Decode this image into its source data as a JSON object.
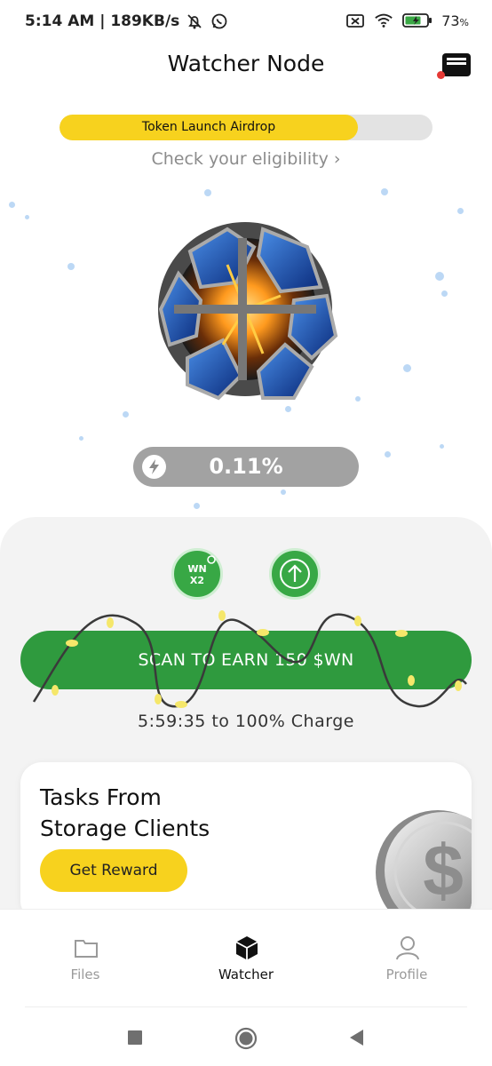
{
  "status_bar": {
    "time_network": "5:14 AM | 189KB/s",
    "battery": "73",
    "battery_unit": "%",
    "icons": [
      "mute-bell-icon",
      "whatsapp-icon",
      "sim-off-icon",
      "wifi-icon",
      "battery-charging-icon"
    ]
  },
  "header": {
    "title": "Watcher Node",
    "wallet_icon": "wallet-icon"
  },
  "airdrop": {
    "label": "Token Launch Airdrop",
    "progress": 0.8,
    "eligibility_text": "Check your eligibility ›"
  },
  "charge": {
    "value": "0.11%",
    "icon": "lightning-icon"
  },
  "boosts": {
    "multiplier_line1": "WN",
    "multiplier_line2": "X2",
    "upgrade_icon": "arrow-up-icon"
  },
  "scan": {
    "label": "SCAN TO EARN 150 $WN",
    "timer": "5:59:35 to 100% Charge"
  },
  "task_card": {
    "title_line1": "Tasks From",
    "title_line2": "Storage Clients",
    "button_label": "Get Reward",
    "image_icon": "dollar-coin-icon"
  },
  "nav": {
    "items": [
      {
        "label": "Files",
        "icon": "folder-icon",
        "active": false
      },
      {
        "label": "Watcher",
        "icon": "cube-icon",
        "active": true
      },
      {
        "label": "Profile",
        "icon": "person-icon",
        "active": false
      }
    ]
  },
  "colors": {
    "accent_green": "#2f9a3e",
    "accent_yellow": "#f7d21e",
    "pill_gray": "#a2a2a2",
    "panel_bg": "#f3f3f3"
  }
}
